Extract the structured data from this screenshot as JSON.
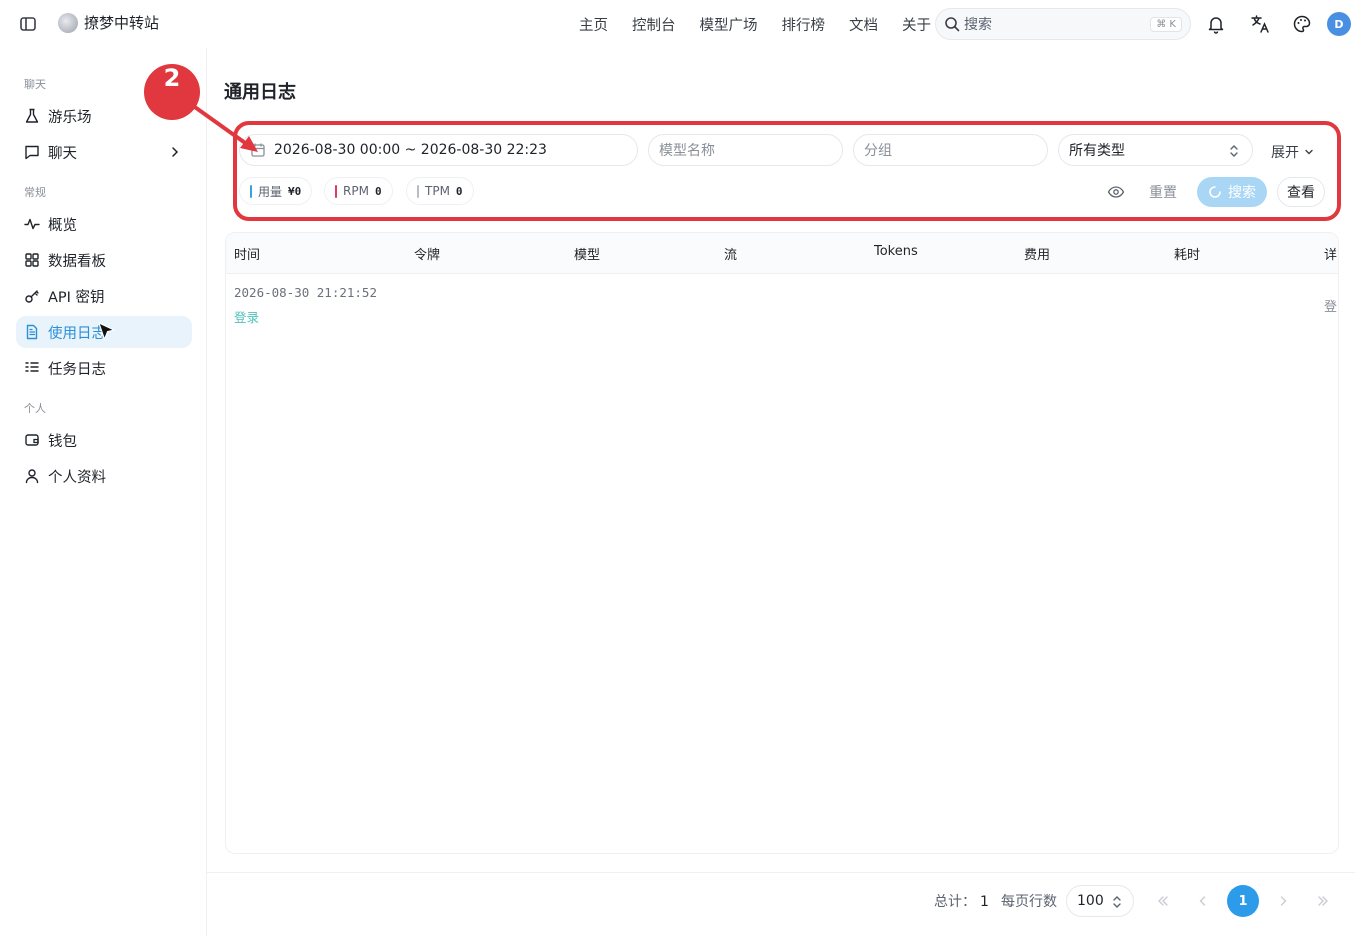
{
  "app": {
    "name": "撩梦中转站"
  },
  "nav": [
    "主页",
    "控制台",
    "模型广场",
    "排行榜",
    "文档",
    "关于"
  ],
  "search": {
    "placeholder": "搜索",
    "shortcut": "⌘ K"
  },
  "user": {
    "avatar_letter": "D"
  },
  "sidebar": {
    "sections": [
      {
        "label": "聊天"
      },
      {
        "label": "常规"
      },
      {
        "label": "个人"
      }
    ],
    "items": [
      {
        "label": "游乐场",
        "icon": "flask-icon"
      },
      {
        "label": "聊天",
        "icon": "chat-icon"
      },
      {
        "label": "概览",
        "icon": "activity-icon"
      },
      {
        "label": "数据看板",
        "icon": "dashboard-icon"
      },
      {
        "label": "API 密钥",
        "icon": "key-icon"
      },
      {
        "label": "使用日志",
        "icon": "document-icon",
        "active": true
      },
      {
        "label": "任务日志",
        "icon": "list-icon"
      },
      {
        "label": "钱包",
        "icon": "wallet-icon"
      },
      {
        "label": "个人资料",
        "icon": "user-icon"
      }
    ]
  },
  "main": {
    "title": "通用日志",
    "filters": {
      "date_range": "2026-08-30 00:00 ~ 2026-08-30 22:23",
      "model_placeholder": "模型名称",
      "group_placeholder": "分组",
      "type_value": "所有类型",
      "expand_label": "展开"
    },
    "stats": [
      {
        "label": "用量",
        "value": "¥0",
        "color": "#3aa0e0"
      },
      {
        "label": "RPM",
        "value": "0",
        "color": "#e0385e"
      },
      {
        "label": "TPM",
        "value": "0",
        "color": "#9aa0aa"
      }
    ],
    "actions": {
      "reset": "重置",
      "search": "搜索",
      "view": "查看"
    },
    "table": {
      "columns": [
        "时间",
        "令牌",
        "模型",
        "流",
        "Tokens",
        "费用",
        "耗时",
        "详"
      ],
      "rows": [
        {
          "time": "2026-08-30 21:21:52",
          "type": "登录",
          "detail": "登"
        }
      ]
    }
  },
  "pagination": {
    "total_label": "总计：",
    "total": "1",
    "rows_label": "每页行数",
    "page_size": "100",
    "current_page": "1"
  },
  "annotation": {
    "step_number": "2",
    "color": "#e0383e"
  }
}
